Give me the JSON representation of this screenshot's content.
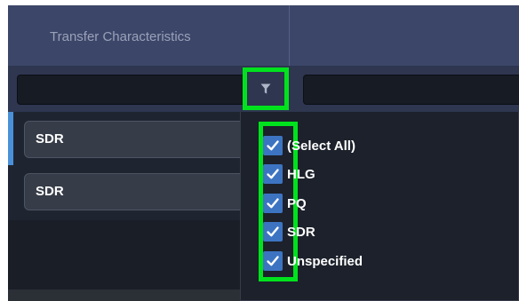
{
  "grid": {
    "header": {
      "column_label": "Transfer Characteristics",
      "next_column_label": ""
    },
    "rows": [
      {
        "value": "SDR",
        "selected": true
      },
      {
        "value": "SDR",
        "selected": false
      }
    ]
  },
  "filter_menu": {
    "options": [
      {
        "label": "(Select All)",
        "checked": true
      },
      {
        "label": "HLG",
        "checked": true
      },
      {
        "label": "PQ",
        "checked": true
      },
      {
        "label": "SDR",
        "checked": true
      },
      {
        "label": "Unspecified",
        "checked": true
      }
    ]
  },
  "icons": {
    "filter_button": "filter-icon",
    "checkbox_mark": "checkmark-icon"
  },
  "colors": {
    "header_bg": "#3c4669",
    "highlight": "#00e21d",
    "checkbox": "#3d74c2",
    "selected_row_bar": "#4a90d9"
  }
}
